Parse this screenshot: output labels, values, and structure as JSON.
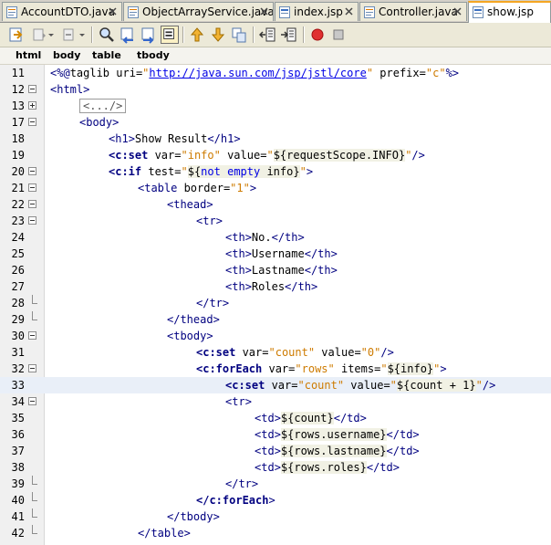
{
  "tabs": [
    {
      "label": "AccountDTO.java",
      "icon": "java-file-icon",
      "active": false
    },
    {
      "label": "ObjectArrayService.java",
      "icon": "java-file-icon",
      "active": false
    },
    {
      "label": "index.jsp",
      "icon": "jsp-file-icon",
      "active": false
    },
    {
      "label": "Controller.java",
      "icon": "java-file-icon",
      "active": false
    },
    {
      "label": "show.jsp",
      "icon": "jsp-file-icon",
      "active": true
    }
  ],
  "toolbar": {
    "buttons": [
      "last-edit-icon",
      "back-icon",
      "forward-icon",
      "find-selection-icon",
      "find-previous-icon",
      "find-next-icon",
      "toggle-highlight-icon",
      "previous-bookmark-icon",
      "next-bookmark-icon",
      "toggle-bookmark-icon",
      "shift-left-icon",
      "shift-right-icon",
      "start-macro-icon",
      "stop-macro-icon"
    ]
  },
  "breadcrumb": [
    "html",
    "body",
    "table",
    "tbody"
  ],
  "editor": {
    "current_line": "33",
    "lines": [
      {
        "n": "11",
        "fold": "none",
        "code": "<%@taglib uri=\"http://java.sun.com/jsp/jstl/core\" prefix=\"c\"%>"
      },
      {
        "n": "12",
        "fold": "open",
        "code": "<html>"
      },
      {
        "n": "13",
        "fold": "closed",
        "code": "<.../>"
      },
      {
        "n": "17",
        "fold": "open",
        "code": "<body>"
      },
      {
        "n": "18",
        "fold": "none",
        "code": "<h1>Show Result</h1>"
      },
      {
        "n": "19",
        "fold": "none",
        "code": "<c:set var=\"info\" value=\"${requestScope.INFO}\"/>"
      },
      {
        "n": "20",
        "fold": "open",
        "code": "<c:if test=\"${not empty info}\">"
      },
      {
        "n": "21",
        "fold": "open",
        "code": "<table border=\"1\">"
      },
      {
        "n": "22",
        "fold": "open",
        "code": "<thead>"
      },
      {
        "n": "23",
        "fold": "open",
        "code": "<tr>"
      },
      {
        "n": "24",
        "fold": "none",
        "code": "<th>No.</th>"
      },
      {
        "n": "25",
        "fold": "none",
        "code": "<th>Username</th>"
      },
      {
        "n": "26",
        "fold": "none",
        "code": "<th>Lastname</th>"
      },
      {
        "n": "27",
        "fold": "none",
        "code": "<th>Roles</th>"
      },
      {
        "n": "28",
        "fold": "end",
        "code": "</tr>"
      },
      {
        "n": "29",
        "fold": "end",
        "code": "</thead>"
      },
      {
        "n": "30",
        "fold": "open",
        "code": "<tbody>"
      },
      {
        "n": "31",
        "fold": "none",
        "code": "<c:set var=\"count\" value=\"0\"/>"
      },
      {
        "n": "32",
        "fold": "open",
        "code": "<c:forEach var=\"rows\" items=\"${info}\">"
      },
      {
        "n": "33",
        "fold": "none",
        "code": "<c:set var=\"count\" value=\"${count + 1}\"/>"
      },
      {
        "n": "34",
        "fold": "open",
        "code": "<tr>"
      },
      {
        "n": "35",
        "fold": "none",
        "code": "<td>${count}</td>"
      },
      {
        "n": "36",
        "fold": "none",
        "code": "<td>${rows.username}</td>"
      },
      {
        "n": "37",
        "fold": "none",
        "code": "<td>${rows.lastname}</td>"
      },
      {
        "n": "38",
        "fold": "none",
        "code": "<td>${rows.roles}</td>"
      },
      {
        "n": "39",
        "fold": "end",
        "code": "</tr>"
      },
      {
        "n": "40",
        "fold": "end",
        "code": "</c:forEach>"
      },
      {
        "n": "41",
        "fold": "end",
        "code": "</tbody>"
      },
      {
        "n": "42",
        "fold": "end",
        "code": "</table>"
      }
    ]
  },
  "colors": {
    "tag": "#000080",
    "attribute": "#008000",
    "string": "#ce7b00",
    "el_keyword": "#0000e6",
    "current_line": "#e9eff8",
    "active_tab_accent": "#f5a623"
  }
}
